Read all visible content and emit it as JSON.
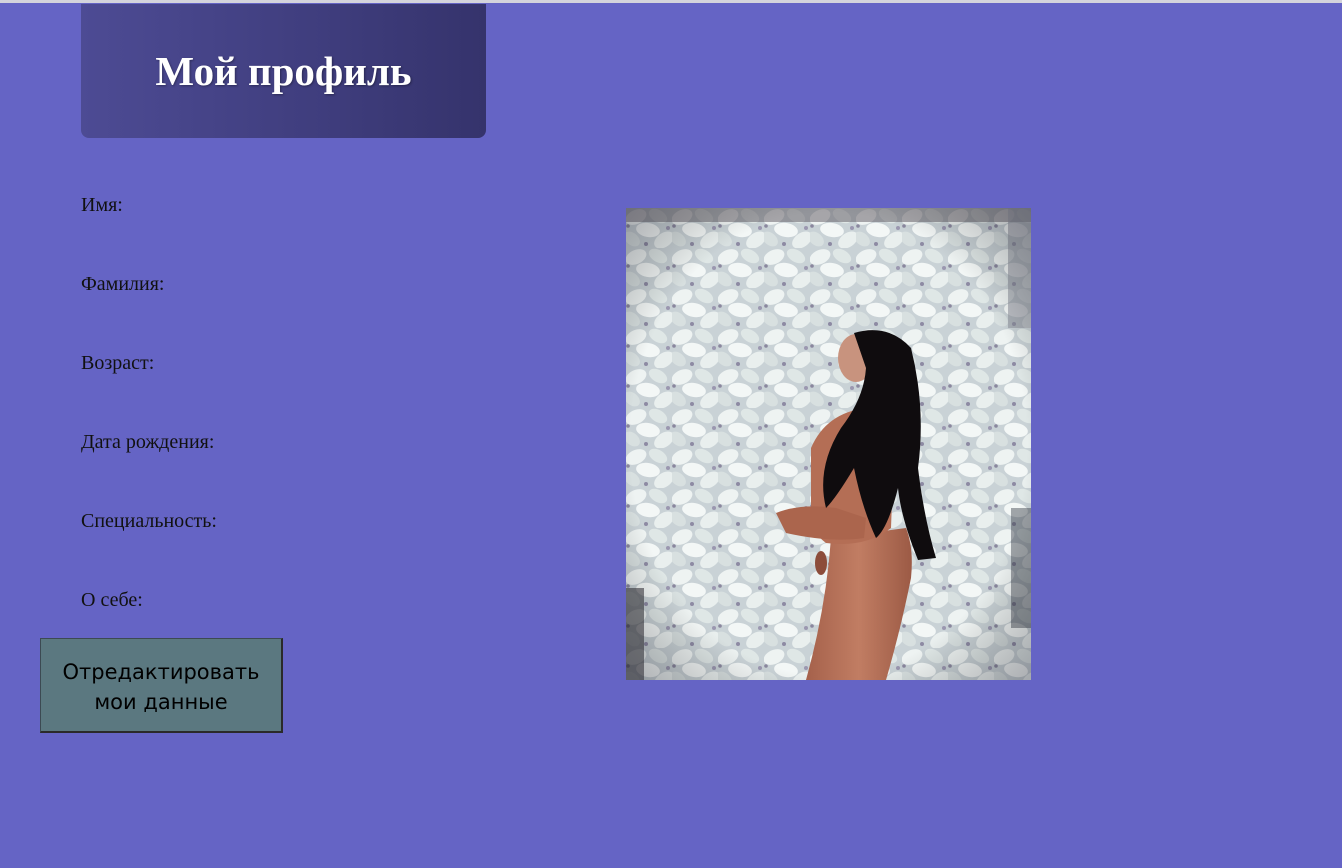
{
  "header": {
    "title": "Мой профиль"
  },
  "profile": {
    "fields": [
      {
        "label": "Имя:"
      },
      {
        "label": "Фамилия:"
      },
      {
        "label": "Возраст:"
      },
      {
        "label": "Дата рождения:"
      },
      {
        "label": "Специальность:"
      },
      {
        "label": "О себе:"
      }
    ],
    "edit_button_line1": "Отредактировать",
    "edit_button_line2": "мои данные"
  },
  "colors": {
    "page_background": "#6564c5",
    "banner_start": "#4d4b94",
    "banner_end": "#35336c",
    "button_background": "#5b7880"
  }
}
